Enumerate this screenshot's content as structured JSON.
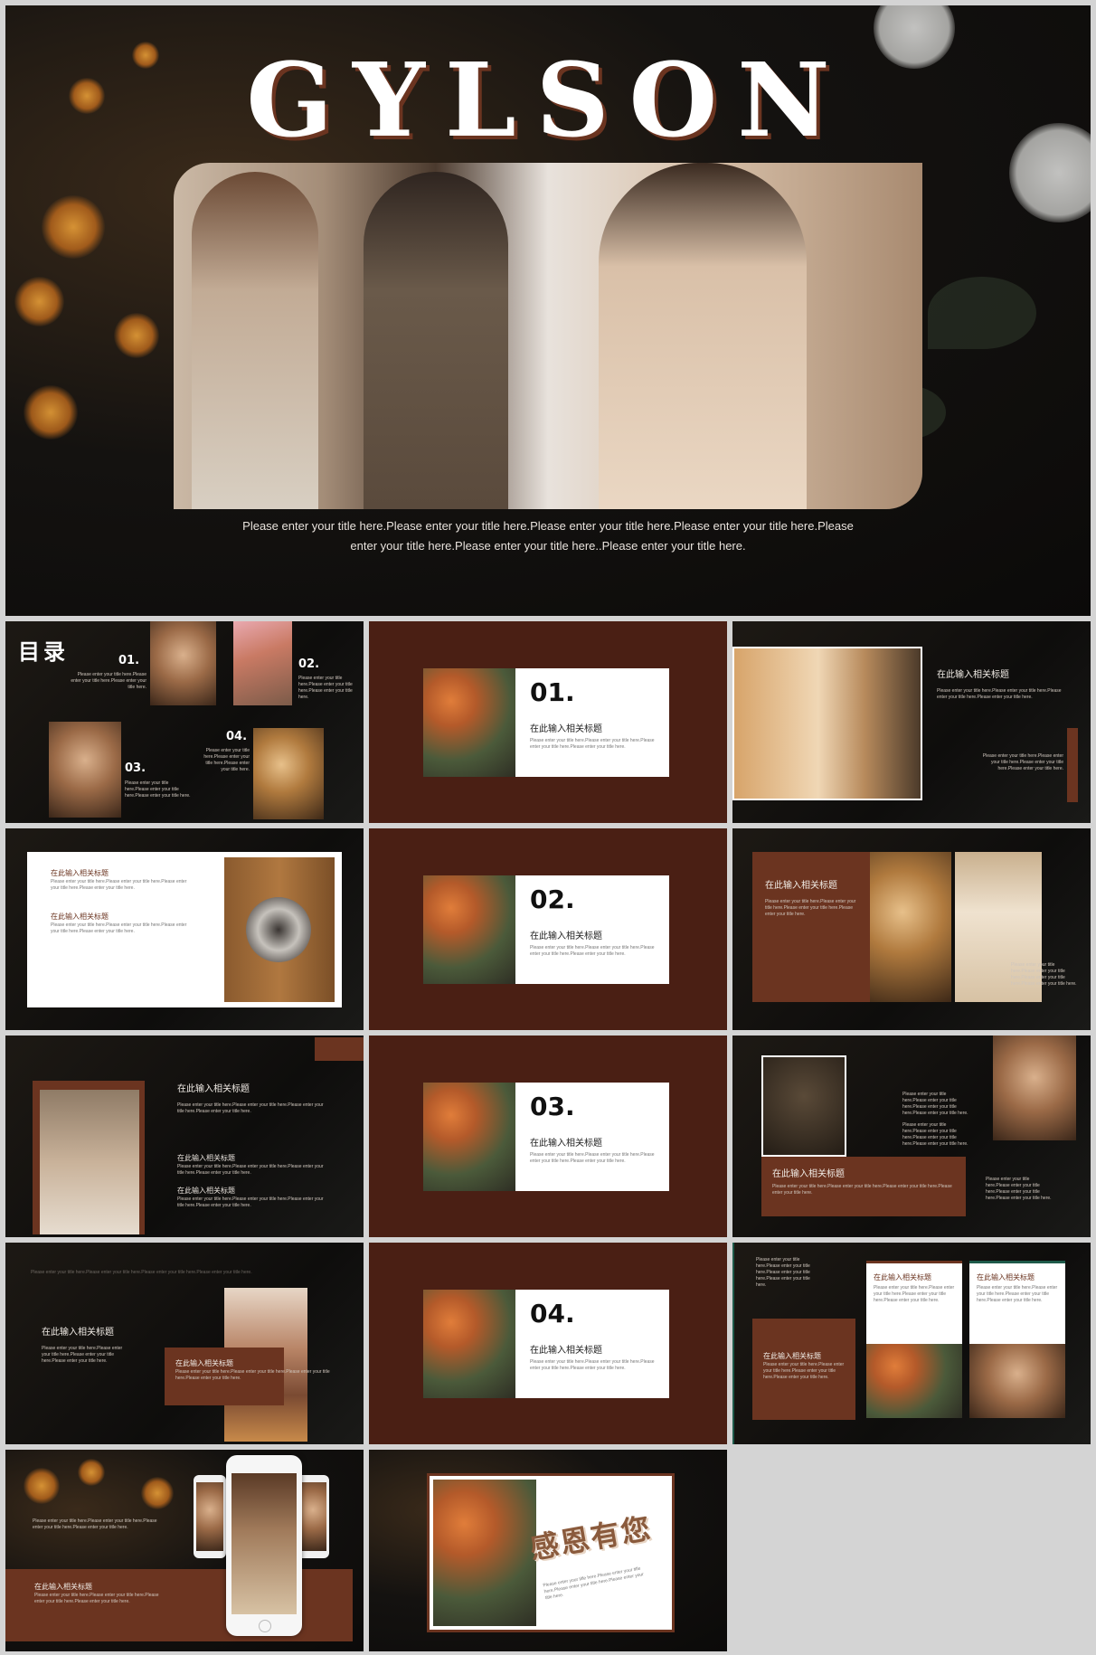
{
  "cover": {
    "title": "GYLSON",
    "subtitle_line1": "Please enter your title here.Please enter your title here.Please enter your title here.Please enter your title here.Please",
    "subtitle_line2": "enter your title here.Please enter your title here..Please enter your title here."
  },
  "toc": {
    "heading": "目录",
    "items": [
      {
        "num": "01.",
        "text": "Please enter your title here.Please enter your title here.Please enter your title here."
      },
      {
        "num": "02.",
        "text": "Please enter your title here.Please enter your title here.Please enter your title here."
      },
      {
        "num": "03.",
        "text": "Please enter your title here.Please enter your title here.Please enter your title here."
      },
      {
        "num": "04.",
        "text": "Please enter your title here.Please enter your title here.Please enter your title here."
      }
    ]
  },
  "section_heading": "在此输入相关标题",
  "section_body": "Please enter your title here.Please enter your title here.Please enter your title here.Please enter your title here.",
  "sections": [
    {
      "num": "01."
    },
    {
      "num": "02."
    },
    {
      "num": "03."
    },
    {
      "num": "04."
    }
  ],
  "closing": {
    "title": "感恩有您",
    "body": "Please enter your title here.Please enter your title here.Please enter your title here.Please enter your title here."
  },
  "colors": {
    "background": "#d4d4d4",
    "brown": "#4a1f14",
    "rust": "#6b3420",
    "dark": "#0b0a09"
  }
}
